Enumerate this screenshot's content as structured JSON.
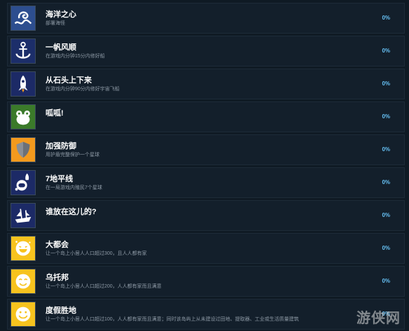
{
  "achievements": [
    {
      "title": "海洋之心",
      "desc": "部署海怪",
      "pct": "0%",
      "icon": "wave-icon"
    },
    {
      "title": "一帆风顺",
      "desc": "在游戏内分钟15分内修好船",
      "pct": "0%",
      "icon": "anchor-icon"
    },
    {
      "title": "从石头上下来",
      "desc": "在游戏内分钟90分内修好宇宙飞船",
      "pct": "0%",
      "icon": "rocket-icon"
    },
    {
      "title": "呱呱!",
      "desc": "",
      "pct": "0%",
      "icon": "frog-icon"
    },
    {
      "title": "加强防御",
      "desc": "用护盾完整保护一个星球",
      "pct": "0%",
      "icon": "shield-icon"
    },
    {
      "title": "7地平线",
      "desc": "在一局游戏内殖民7个星球",
      "pct": "0%",
      "icon": "astronaut-icon"
    },
    {
      "title": "谁放在这儿的?",
      "desc": "",
      "pct": "0%",
      "icon": "shipwreck-icon"
    },
    {
      "title": "大都会",
      "desc": "让一个岛上小居人人口超过300，且人人都有家",
      "pct": "0%",
      "icon": "laughing-face-icon"
    },
    {
      "title": "乌托邦",
      "desc": "让一个岛上小居人人口超过200，人人都有家而且满意",
      "pct": "0%",
      "icon": "smiling-face-icon"
    },
    {
      "title": "度假胜地",
      "desc": "让一个岛上小居人人口超过100，人人都有家而且满意；同时该岛屿上从未建设过田地、提取器、工业或生活质量建筑",
      "pct": "0%",
      "icon": "happy-face-icon"
    }
  ],
  "colors": {
    "wave_bg": "#2d4e8f",
    "anchor_bg": "#1c2e6a",
    "rocket_bg": "#1c2a66",
    "frog_bg": "#3b7a2a",
    "shield_bg": "#f39a1e",
    "astronaut_bg": "#1c2a66",
    "ship_bg": "#1c2a66",
    "face_bg": "#f7c31e",
    "percent": "#66c0f4"
  },
  "watermark": "游侠网"
}
